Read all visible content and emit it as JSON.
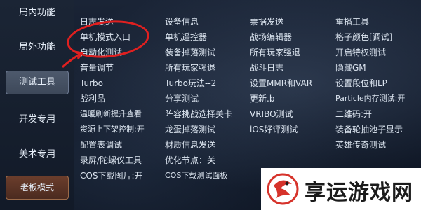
{
  "sidebar": {
    "items": [
      {
        "label": "局内功能"
      },
      {
        "label": "局外功能"
      },
      {
        "label": "测试工具"
      },
      {
        "label": "开发专用"
      },
      {
        "label": "美术专用"
      },
      {
        "label": "老板模式"
      }
    ]
  },
  "menu": {
    "rows": [
      [
        "日志发送",
        "设备信息",
        "票据发送",
        "重播工具"
      ],
      [
        "单机模式入口",
        "单机遥控器",
        "战场编辑器",
        "格子颜色[调试]"
      ],
      [
        "自动化测试",
        "装备掉落测试",
        "所有玩家强退",
        "开启特权测试"
      ],
      [
        "音量调节",
        "所有玩家强退",
        "战斗日志",
        "隐藏GM"
      ],
      [
        "Turbo",
        "Turbo玩法--2",
        "设置MMR和VAR",
        "设置段位和LP"
      ],
      [
        "战利品",
        "分享测试",
        "更新.b",
        "Particle内存测试:开"
      ],
      [
        "温暖刷新提升查看",
        "阵容挑战选择关卡",
        "VRIBO测试",
        "二维码:开"
      ],
      [
        "资源上下架控制:开",
        "龙蛋掉落测试",
        "iOS好评测试",
        "装备轮抽池子显示"
      ],
      [
        "配置表调试",
        "材质信息发送",
        "",
        "英雄传奇测试"
      ],
      [
        "录屏/陀螺仪工具",
        "优化节点：关",
        "",
        ""
      ],
      [
        "COS下载图片:开",
        "COS下载测试面板",
        "",
        ""
      ]
    ]
  },
  "watermark": {
    "text": "享运游戏网"
  },
  "colors": {
    "annotation": "#e02020",
    "active_tab": "#4e5a6d",
    "boss_mode": "#6b3e2c"
  }
}
